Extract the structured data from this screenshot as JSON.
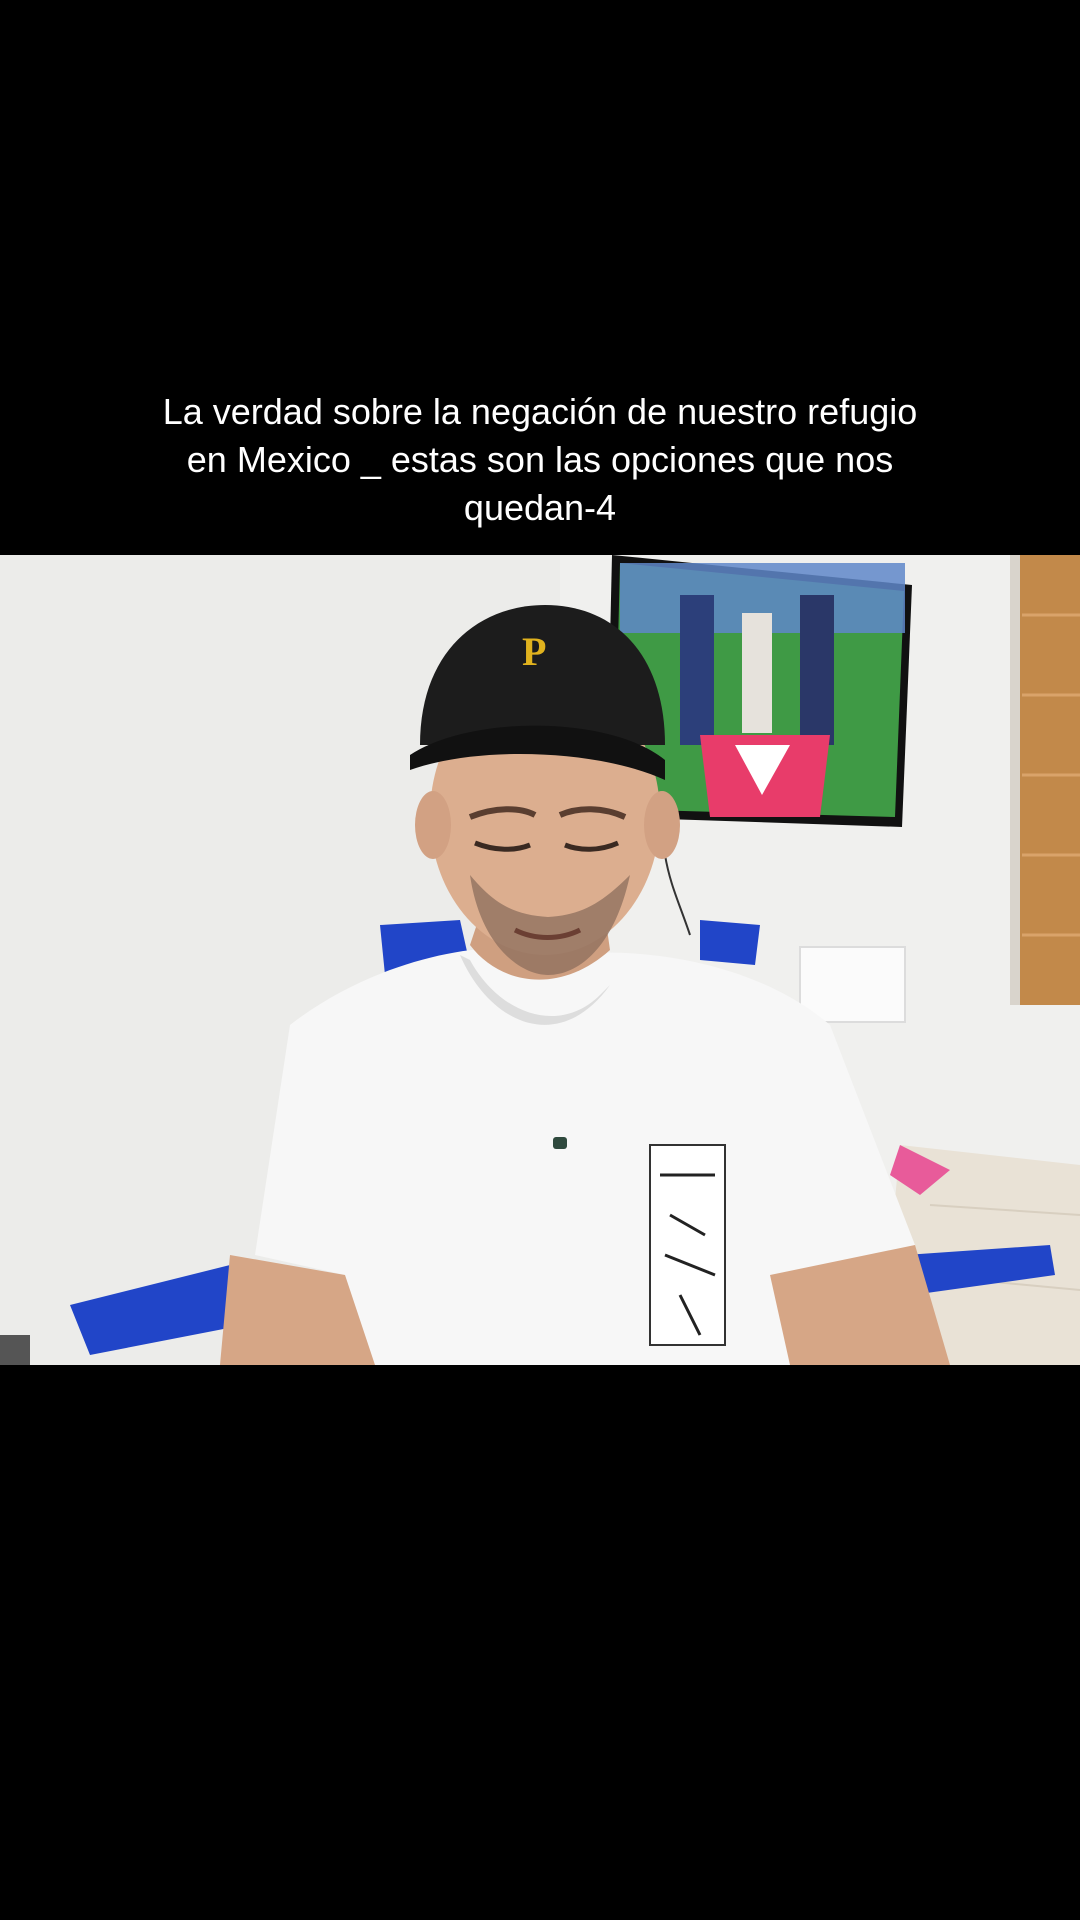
{
  "video": {
    "caption_lines": [
      "La verdad sobre la negación de nuestro refugio",
      "en Mexico _ estas son las opciones que nos",
      "quedan-4"
    ]
  },
  "colors": {
    "background": "#000000",
    "caption_text": "#ffffff",
    "wall": "#f2f2f0",
    "shirt": "#f7f7f7",
    "cap": "#1c1c1c",
    "cap_logo": "#e0b21e",
    "chair": "#2145c8",
    "tv_field": "#3f9a45",
    "window_blind": "#c2894a"
  }
}
